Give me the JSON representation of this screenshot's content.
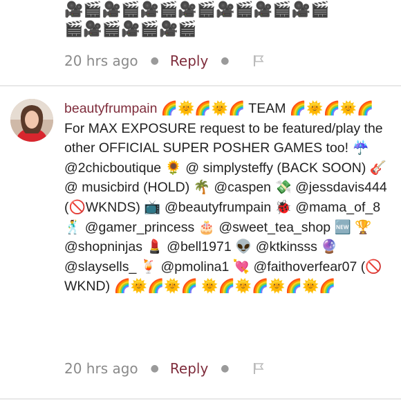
{
  "previous_comment": {
    "emoji_line_1": "🎥🎬🎥🎬🎥🎬🎥🎬🎥🎬🎥🎬🎥🎬",
    "emoji_line_2": "🎬🎥🎬🎥🎬🎥🎬",
    "time": "20 hrs ago",
    "reply_label": "Reply"
  },
  "comment": {
    "username": "beautyfrumpain",
    "body": " 🌈🌞🌈🌞🌈 TEAM 🌈🌞🌈🌞🌈 For MAX EXPOSURE request to be featured/play the other OFFICIAL SUPER POSHER GAMES too! ☔ @2chicboutique 🌻 @ simplysteffy (BACK SOON) 🎸 @ musicbird (HOLD) 🌴 @caspen 💸 @jessdavis444 (🚫WKNDS) 📺 @beautyfrumpain 🐞 @mama_of_8 🕺 @gamer_princess 🎂 @sweet_tea_shop 🆕 🏆 @shopninjas 💄 @bell1971 👽 @ktkinsss 🔮 @slaysells_ 🍹 @pmolina1 💘 @faithoverfear07 (🚫WKND) 🌈🌞🌈🌞🌈 🌞🌈🌞🌈🌞🌈🌞🌈",
    "time": "20 hrs ago",
    "reply_label": "Reply"
  }
}
